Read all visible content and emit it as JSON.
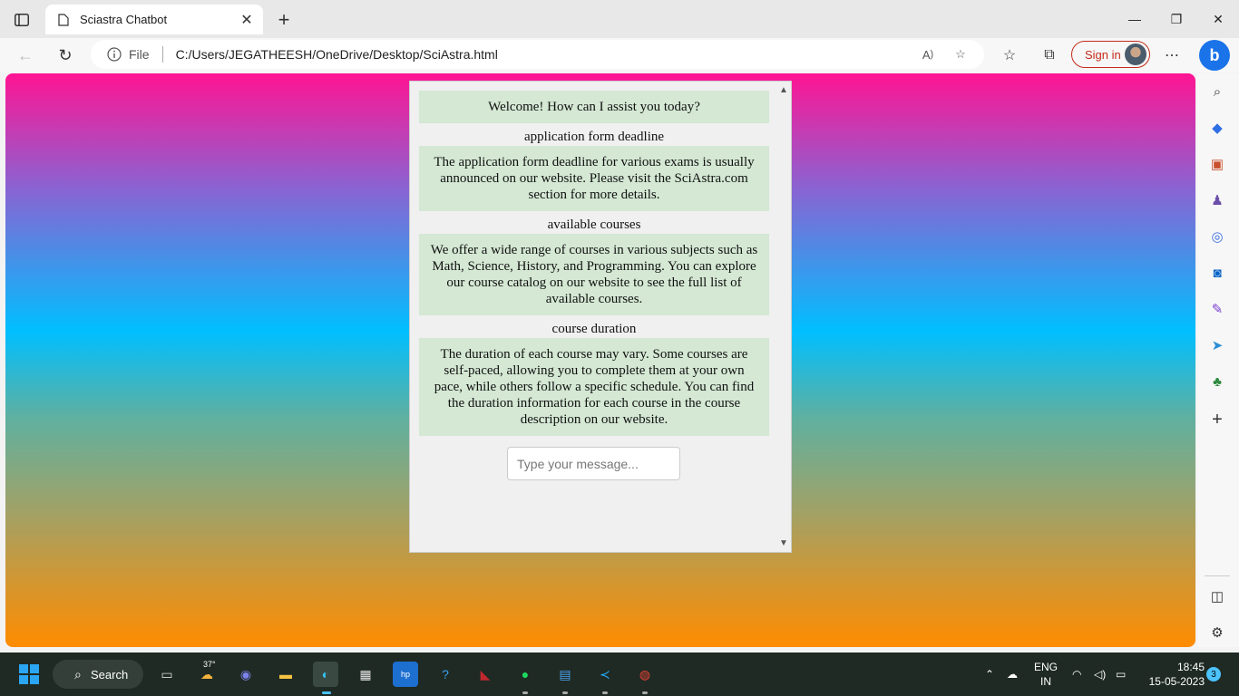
{
  "browser": {
    "tab_title": "Sciastra Chatbot",
    "address_scheme": "File",
    "address_url": "C:/Users/JEGATHEESH/OneDrive/Desktop/SciAstra.html",
    "signin_label": "Sign in"
  },
  "chat": {
    "messages": [
      {
        "role": "bot",
        "text": "Welcome! How can I assist you today?"
      },
      {
        "role": "user",
        "text": "application form deadline"
      },
      {
        "role": "bot",
        "text": "The application form deadline for various exams is usually announced on our website. Please visit the SciAstra.com section for more details."
      },
      {
        "role": "user",
        "text": "available courses"
      },
      {
        "role": "bot",
        "text": "We offer a wide range of courses in various subjects such as Math, Science, History, and Programming. You can explore our course catalog on our website to see the full list of available courses."
      },
      {
        "role": "user",
        "text": "course duration"
      },
      {
        "role": "bot",
        "text": "The duration of each course may vary. Some courses are self-paced, allowing you to complete them at your own pace, while others follow a specific schedule. You can find the duration information for each course in the course description on our website."
      }
    ],
    "input_placeholder": "Type your message..."
  },
  "taskbar": {
    "search_label": "Search",
    "weather_temp": "37°",
    "language_line1": "ENG",
    "language_line2": "IN",
    "time": "18:45",
    "date": "15-05-2023",
    "notification_count": "3"
  },
  "colors": {
    "gradient_top": "#ff1493",
    "gradient_mid": "#00bfff",
    "gradient_bottom": "#ff8c00",
    "bot_bubble": "#d4e8d4",
    "signin_accent": "#c42b1c"
  },
  "icons": [
    "tab-actions-icon",
    "page-icon",
    "close-icon",
    "new-tab-icon",
    "minimize-icon",
    "restore-icon",
    "window-close-icon",
    "back-icon",
    "refresh-icon",
    "info-icon",
    "read-aloud-icon",
    "add-favorite-icon",
    "favorites-icon",
    "collections-icon",
    "more-icon",
    "bing-icon",
    "search-icon",
    "shopping-icon",
    "tools-icon",
    "games-icon",
    "office-icon",
    "outlook-icon",
    "designer-icon",
    "telegram-icon",
    "tree-icon",
    "add-icon",
    "split-screen-icon",
    "settings-icon"
  ]
}
